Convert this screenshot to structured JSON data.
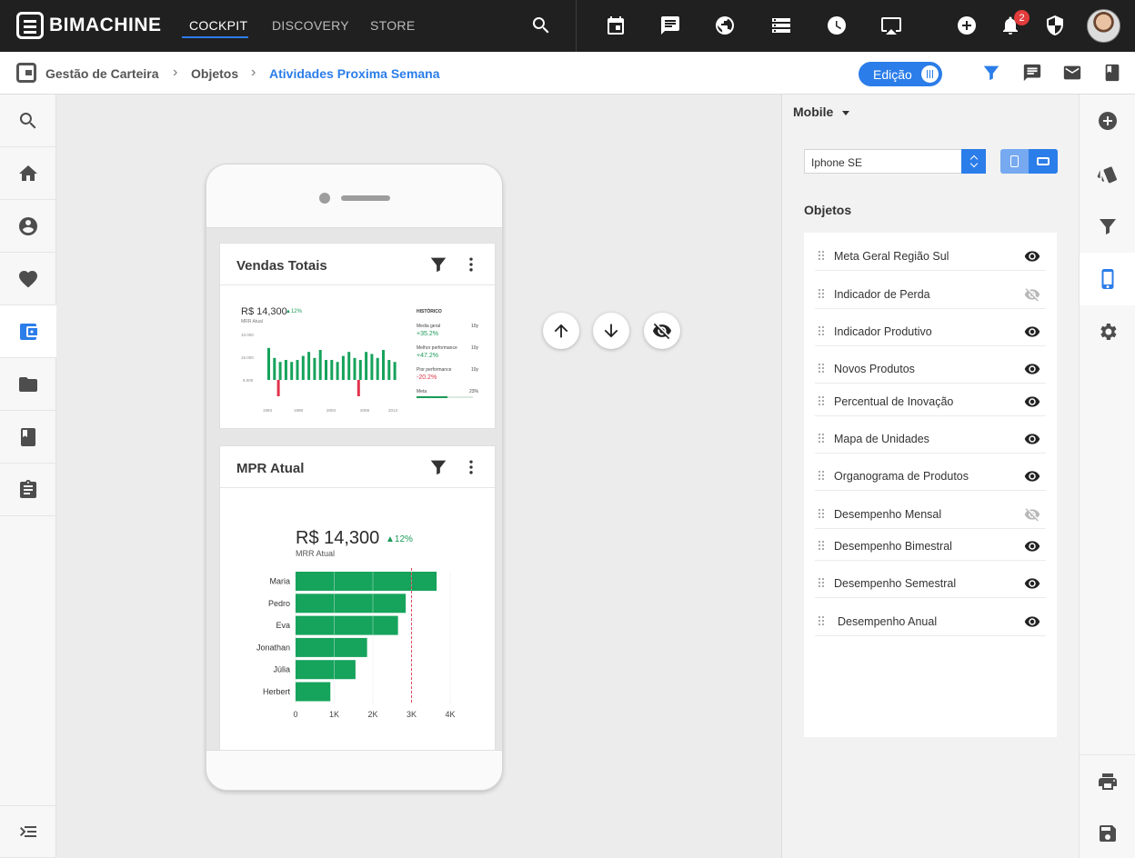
{
  "brand": {
    "name": "BIMACHINE"
  },
  "nav": {
    "tabs": [
      {
        "label": "COCKPIT",
        "active": true
      },
      {
        "label": "DISCOVERY",
        "active": false
      },
      {
        "label": "STORE",
        "active": false
      }
    ]
  },
  "top_icons": [
    "search-icon",
    "calendar-icon",
    "chat-icon",
    "globe-icon",
    "server-icon",
    "clock-icon",
    "cast-icon",
    "add-icon",
    "bell-icon",
    "shield-icon"
  ],
  "notifications": {
    "count": "2"
  },
  "breadcrumb": {
    "items": [
      "Gestão de Carteira",
      "Objetos",
      "Atividades Proxima Semana"
    ]
  },
  "edit_toggle": {
    "label": "Edição",
    "on": true
  },
  "left_nav": [
    "search-icon",
    "home-icon",
    "account-icon",
    "heart-icon",
    "wallet-icon",
    "folder-icon",
    "book-icon",
    "clipboard-icon",
    "menu-expand-icon"
  ],
  "cards": {
    "vendas": {
      "title": "Vendas Totais",
      "value": "R$ 14,300",
      "delta": "▲12%",
      "sub": "MRR Atual",
      "y_ticks": [
        "10.000",
        "15.000",
        "9.000"
      ],
      "x_ticks": [
        "1993",
        "1998",
        "2003",
        "2008",
        "2013"
      ],
      "side": {
        "header": "HISTÓRICO",
        "rows": [
          {
            "label": "Media geral",
            "span": "10y",
            "value": "+35.2%"
          },
          {
            "label": "Melhor performance",
            "span": "10y",
            "value": "+47.2%"
          },
          {
            "label": "Pior performance",
            "span": "10y",
            "value": "-20.2%"
          },
          {
            "label": "Meta",
            "span": "23%",
            "progress": 0.55
          }
        ]
      }
    },
    "mrr": {
      "title": "MPR Atual",
      "value": "R$ 14,300",
      "delta": "▲12%",
      "sub": "MRR Atual"
    }
  },
  "chart_data": {
    "type": "bar",
    "orientation": "horizontal",
    "categories": [
      "Maria",
      "Pedro",
      "Eva",
      "Jonathan",
      "Júlia",
      "Herbert"
    ],
    "values": [
      3650,
      2850,
      2650,
      1850,
      1550,
      900
    ],
    "xticks": [
      "0",
      "1K",
      "2K",
      "3K",
      "4K"
    ],
    "xlim": [
      0,
      4000
    ],
    "target": 3000,
    "bar_color": "#16a35c",
    "target_color": "#e04a5a"
  },
  "mini_chart": {
    "values": [
      0.8,
      0.55,
      0.45,
      0.5,
      0.45,
      0.5,
      0.6,
      0.7,
      0.55,
      0.75,
      0.5,
      0.5,
      0.45,
      0.6,
      0.7,
      0.55,
      0.5,
      0.7,
      0.65,
      0.55,
      0.75,
      0.5,
      0.45
    ],
    "negatives": [
      2,
      16
    ],
    "bar_color": "#16a35c",
    "neg_color": "#e0334d"
  },
  "right_panel": {
    "view_label": "Mobile",
    "device": "Iphone SE",
    "objects_title": "Objetos",
    "objects": [
      {
        "label": "Meta Geral Região Sul",
        "visible": true
      },
      {
        "label": "Indicador de Perda",
        "visible": false
      },
      {
        "label": "Indicador Produtivo",
        "visible": true
      },
      {
        "label": "Novos Produtos",
        "visible": true
      },
      {
        "label": "Percentual de Inovação",
        "visible": true
      },
      {
        "label": "Mapa de Unidades",
        "visible": true
      },
      {
        "label": "Organograma de Produtos",
        "visible": true
      },
      {
        "label": "Desempenho Mensal",
        "visible": false
      },
      {
        "label": "Desempenho Bimestral",
        "visible": true
      },
      {
        "label": "Desempenho Semestral",
        "visible": true
      },
      {
        "label": "Desempenho Anual",
        "visible": true
      }
    ]
  },
  "right_tools": [
    "add-circle-icon",
    "cards-icon",
    "filter-icon",
    "phone-icon",
    "settings-icon",
    "print-icon",
    "save-icon"
  ],
  "accent": "#2b7de9"
}
